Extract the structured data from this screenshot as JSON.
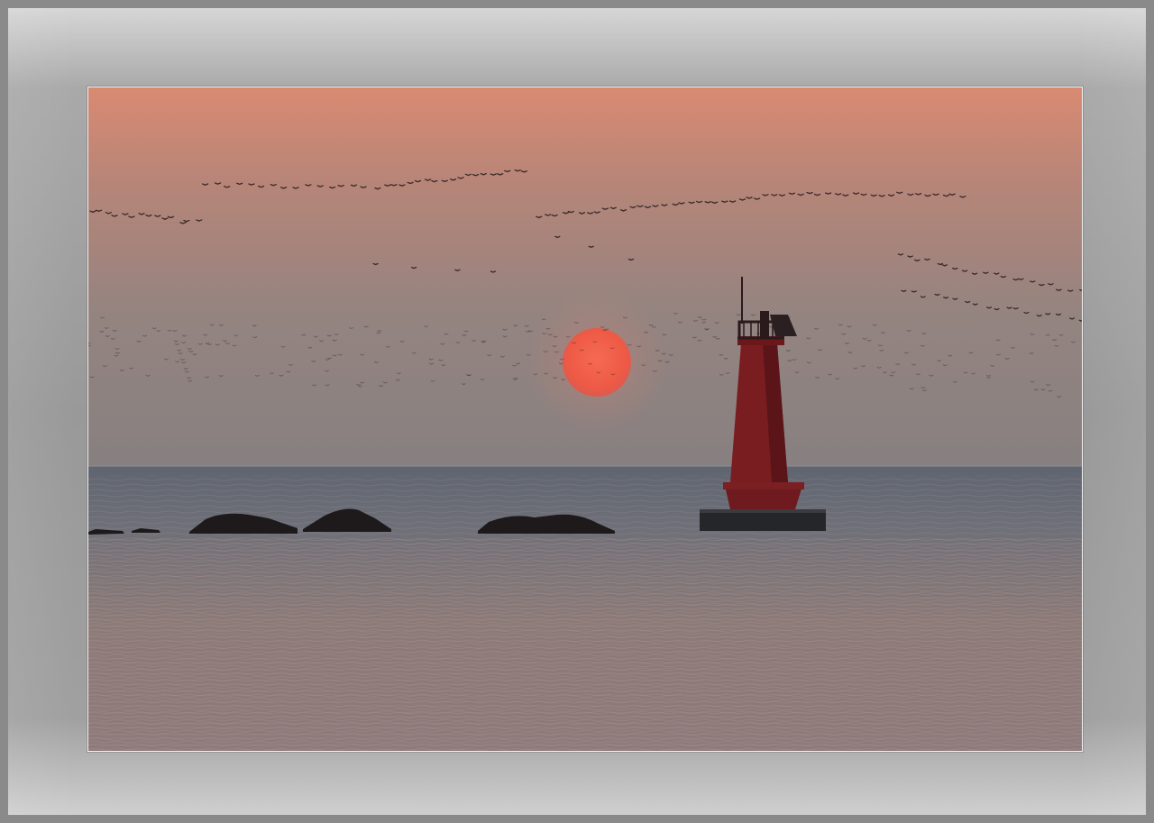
{
  "photo": {
    "subject": "lighthouse-at-sunset",
    "colors": {
      "frame": "#9a9a9a",
      "sky_top": "#d88870",
      "sky_bottom": "#8e8280",
      "sun": "#f0604a",
      "lighthouse": "#7a1a1e",
      "sea": "#6f6f78"
    }
  }
}
